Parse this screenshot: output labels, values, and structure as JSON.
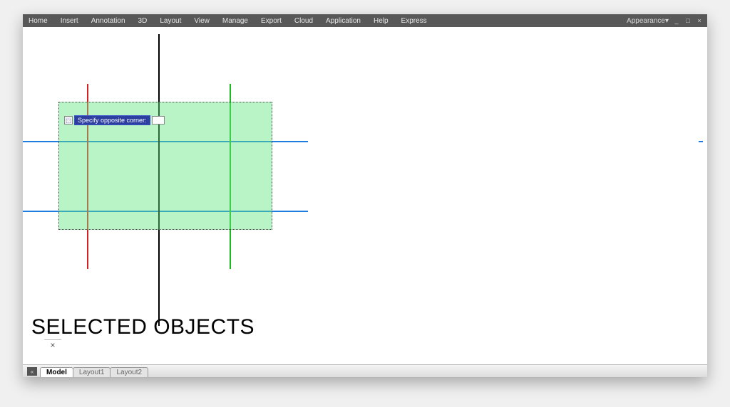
{
  "menubar": {
    "items": [
      "Home",
      "Insert",
      "Annotation",
      "3D",
      "Layout",
      "View",
      "Manage",
      "Export",
      "Cloud",
      "Application",
      "Help",
      "Express"
    ],
    "appearance": "Appearance"
  },
  "canvas": {
    "prompt_icon": "⬚",
    "prompt_label": "Specify opposite corner:",
    "prompt_value": "",
    "title_text": "SELECTED OBJECTS",
    "close_mark": "×"
  },
  "statusbar": {
    "toggle": "«",
    "tabs": [
      "Model",
      "Layout1",
      "Layout2"
    ],
    "active_tab": 0
  },
  "window_controls": {
    "min": "_",
    "restore": "□",
    "close": "×"
  }
}
